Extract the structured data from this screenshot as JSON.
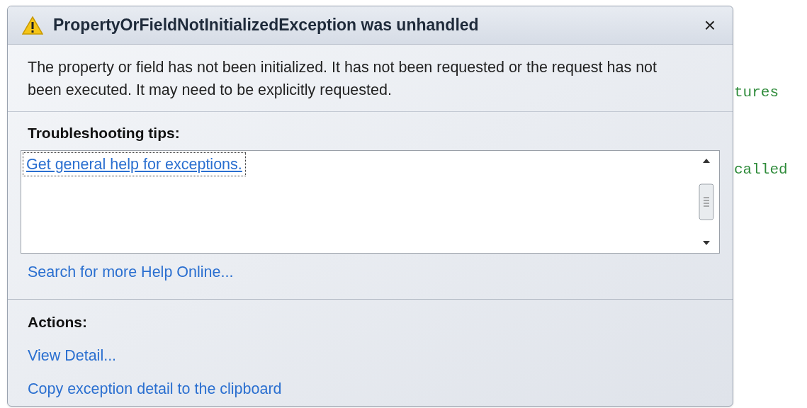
{
  "background_code": [
    "tures",
    "called"
  ],
  "dialog": {
    "title": "PropertyOrFieldNotInitializedException was unhandled",
    "close": "×",
    "message": "The property or field has not been initialized. It has not been requested or the request has not been executed. It may need to be explicitly requested.",
    "tips_heading": "Troubleshooting tips:",
    "tips": [
      {
        "label": "Get general help for exceptions.",
        "selected": true
      }
    ],
    "search_link": "Search for more Help Online...",
    "actions_heading": "Actions:",
    "actions": [
      "View Detail...",
      "Copy exception detail to the clipboard"
    ]
  }
}
